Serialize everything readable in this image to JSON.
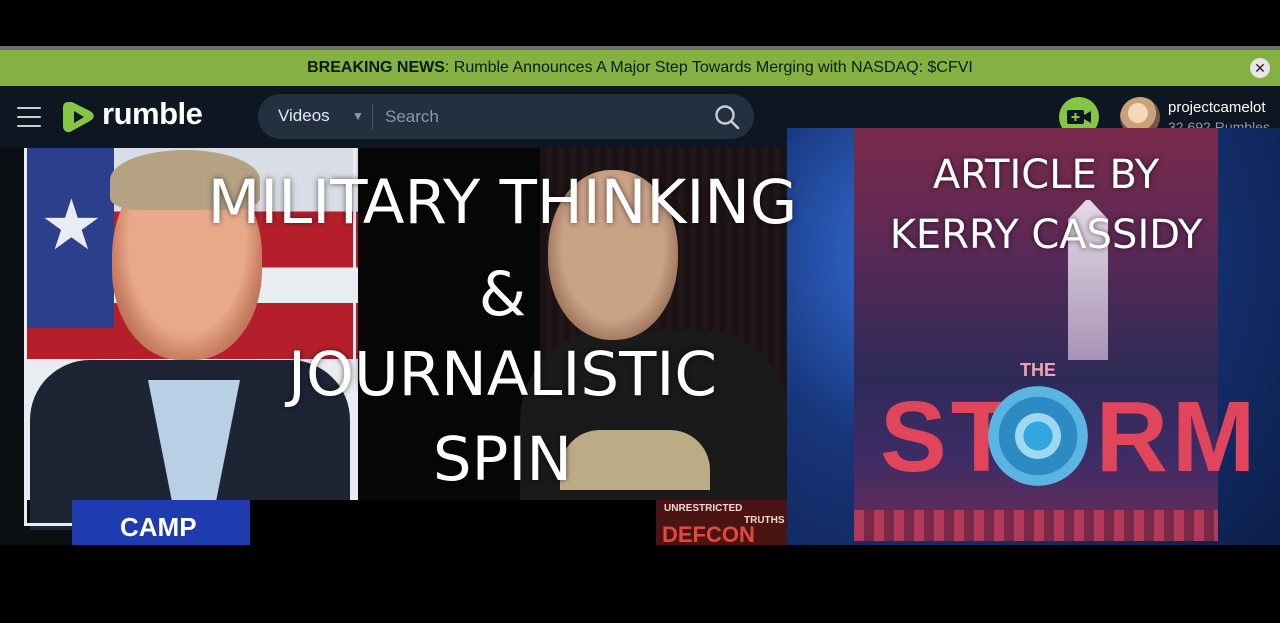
{
  "banner": {
    "label": "BREAKING NEWS",
    "separator": ":",
    "text": " Rumble Announces A Major Step Towards Merging with NASDAQ: $CFVI",
    "close_glyph": "✕"
  },
  "header": {
    "logo_text": "rumble",
    "search": {
      "category": "Videos",
      "placeholder": "Search"
    },
    "user": {
      "name": "projectcamelot",
      "rumbles": "32,692 Rumbles"
    }
  },
  "overlay": {
    "title_line1": "MILITARY THINKING",
    "title_line2": "&",
    "title_line3": "JOURNALISTIC",
    "title_line4": "SPIN",
    "article_line1": "ARTICLE BY",
    "article_line2": "KERRY CASSIDY"
  },
  "poster": {
    "the": "THE",
    "title": "STORM"
  },
  "strips": {
    "left": "CAMP",
    "right_line1": "UNRESTRICTED",
    "right_line2": "TRUTHS",
    "right_line3": "DEFCON"
  },
  "colors": {
    "banner_bg": "#85b143",
    "header_bg": "#0e1621",
    "brand_green": "#85c742"
  },
  "icons": [
    "menu-icon",
    "rumble-logo-icon",
    "chevron-down-icon",
    "search-icon",
    "upload-video-icon",
    "close-icon"
  ]
}
